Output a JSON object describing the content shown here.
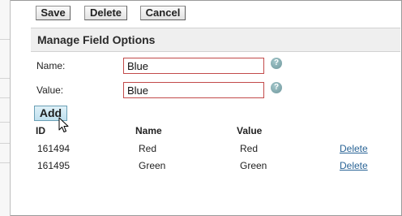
{
  "toolbar": {
    "save_label": "Save",
    "delete_label": "Delete",
    "cancel_label": "Cancel"
  },
  "section": {
    "title": "Manage Field Options"
  },
  "form": {
    "name_label": "Name:",
    "name_value": "Blue",
    "value_label": "Value:",
    "value_value": "Blue",
    "help_icon_glyph": "?",
    "add_label": "Add"
  },
  "table": {
    "columns": [
      "ID",
      "Name",
      "Value"
    ],
    "rows": [
      {
        "id": "161494",
        "name": "Red",
        "value": "Red",
        "action": "Delete"
      },
      {
        "id": "161495",
        "name": "Green",
        "value": "Green",
        "action": "Delete"
      }
    ]
  },
  "colors": {
    "link": "#2a6496",
    "input_border": "#c24a4a",
    "add_button": "#bfe0ee",
    "help_icon": "#6f979c"
  },
  "icons": {
    "help": "help-icon",
    "cursor": "mouse-pointer-icon"
  }
}
